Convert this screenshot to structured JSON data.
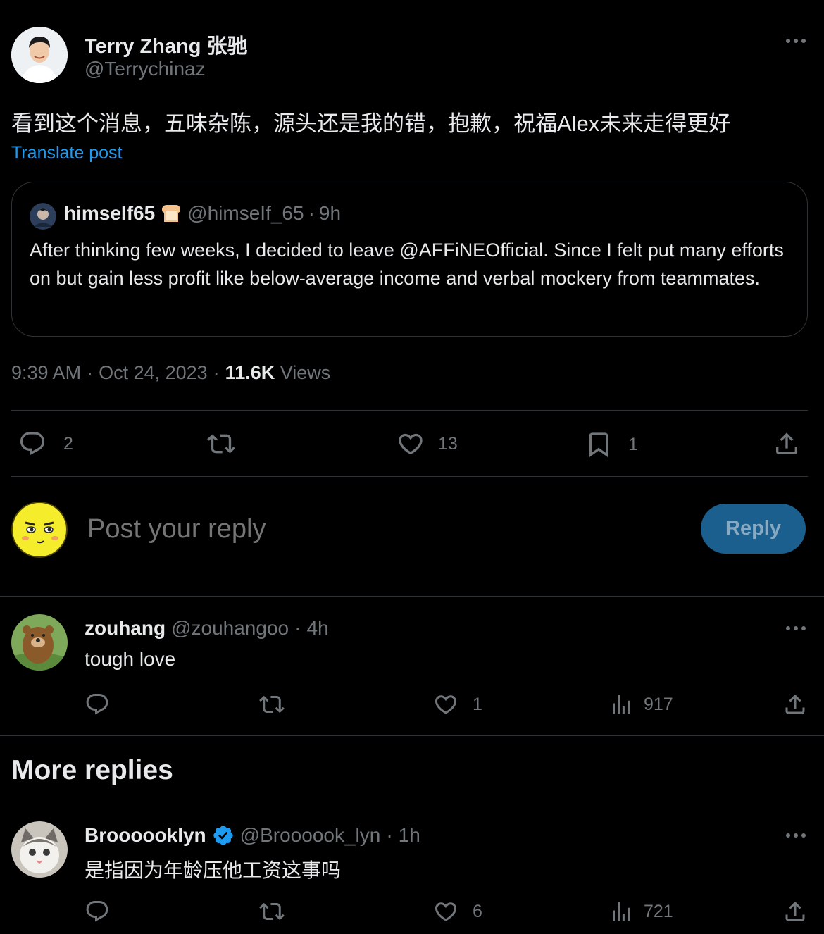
{
  "tweet": {
    "author_name": "Terry Zhang 张驰",
    "author_handle": "@Terrychinaz",
    "text": "看到这个消息，五味杂陈，源头还是我的错，抱歉，祝福Alex未来走得更好",
    "translate_label": "Translate post",
    "quote": {
      "name": "himself65",
      "handle": "@himseIf_65",
      "time": "9h",
      "text": "After thinking few weeks, I decided to leave @AFFiNEOfficial. Since I felt put many efforts on but gain less profit like below-average income and verbal mockery from teammates."
    },
    "time": "9:39 AM",
    "date": "Oct 24, 2023",
    "views_count": "11.6K",
    "views_label": "Views",
    "stats": {
      "replies": "2",
      "likes": "13",
      "bookmarks": "1"
    }
  },
  "composer": {
    "placeholder": "Post your reply",
    "button_label": "Reply"
  },
  "replies": [
    {
      "name": "zouhang",
      "handle": "@zouhangoo",
      "time": "4h",
      "text": "tough love",
      "likes": "1",
      "views": "917"
    }
  ],
  "more_replies_heading": "More replies",
  "more_replies": [
    {
      "name": "Broooooklyn",
      "handle": "@Broooook_lyn",
      "time": "1h",
      "text": "是指因为年龄压他工资这事吗",
      "likes": "6",
      "views": "721"
    }
  ],
  "colors": {
    "background": "#000000",
    "text": "#e7e9ea",
    "muted": "#71767b",
    "link": "#1d9bf0",
    "reply_button_bg": "#1a5f8e",
    "border": "#2f3336"
  }
}
